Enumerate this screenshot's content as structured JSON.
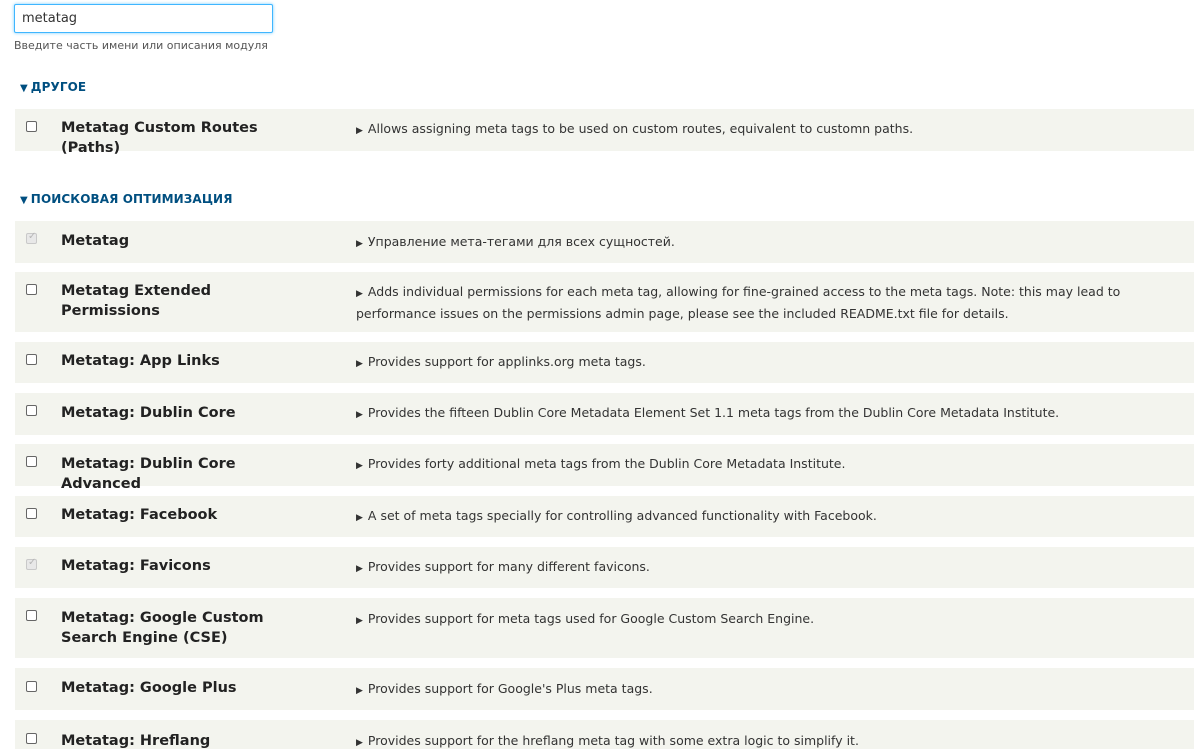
{
  "filter": {
    "value": "metatag",
    "help": "Введите часть имени или описания модуля"
  },
  "groups": [
    {
      "title": "ДРУГОЕ",
      "modules": [
        {
          "name": "Metatag Custom Routes (Paths)",
          "description": "Allows assigning meta tags to be used on custom routes, equivalent to customn paths.",
          "checked": false,
          "disabled": false
        }
      ]
    },
    {
      "title": "ПОИСКОВАЯ ОПТИМИЗАЦИЯ",
      "modules": [
        {
          "name": "Metatag",
          "description": "Управление мета-тегами для всех сущностей.",
          "checked": true,
          "disabled": true
        },
        {
          "name": "Metatag Extended Permissions",
          "description": "Adds individual permissions for each meta tag, allowing for fine-grained access to the meta tags. Note: this may lead to performance issues on the permissions admin page, please see the included README.txt file for details.",
          "checked": false,
          "disabled": false
        },
        {
          "name": "Metatag: App Links",
          "description": "Provides support for applinks.org meta tags.",
          "checked": false,
          "disabled": false
        },
        {
          "name": "Metatag: Dublin Core",
          "description": "Provides the fifteen Dublin Core Metadata Element Set 1.1 meta tags from the Dublin Core Metadata Institute.",
          "checked": false,
          "disabled": false
        },
        {
          "name": "Metatag: Dublin Core Advanced",
          "description": "Provides forty additional meta tags from the Dublin Core Metadata Institute.",
          "checked": false,
          "disabled": false
        },
        {
          "name": "Metatag: Facebook",
          "description": "A set of meta tags specially for controlling advanced functionality with Facebook.",
          "checked": false,
          "disabled": false
        },
        {
          "name": "Metatag: Favicons",
          "description": "Provides support for many different favicons.",
          "checked": true,
          "disabled": true
        },
        {
          "name": "Metatag: Google Custom Search Engine (CSE)",
          "description": "Provides support for meta tags used for Google Custom Search Engine.",
          "checked": false,
          "disabled": false
        },
        {
          "name": "Metatag: Google Plus",
          "description": "Provides support for Google's Plus meta tags.",
          "checked": false,
          "disabled": false
        },
        {
          "name": "Metatag: Hreflang",
          "description": "Provides support for the hreflang meta tag with some extra logic to simplify it.",
          "checked": false,
          "disabled": false
        }
      ]
    }
  ],
  "colors": {
    "row_background": "#f3f4ee",
    "group_title": "#004f80",
    "focus_border": "#40b6ff"
  },
  "icons": {
    "collapse": "triangle-down-icon",
    "details": "triangle-right-icon"
  }
}
